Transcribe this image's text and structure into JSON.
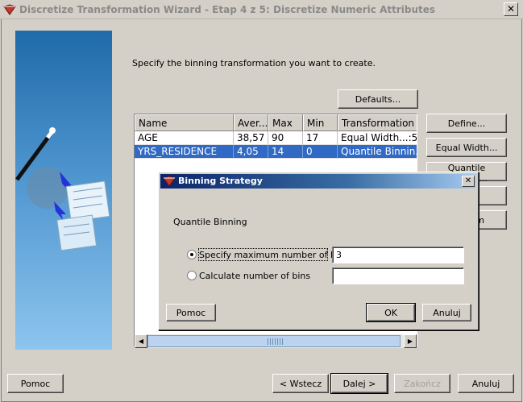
{
  "window": {
    "title": "Discretize Transformation Wizard - Etap 4 z 5: Discretize Numeric Attributes",
    "close_label": "✕"
  },
  "main": {
    "instruction": "Specify the binning transformation you want to create.",
    "defaults_label": "Defaults...",
    "side_buttons": {
      "define": "Define...",
      "equal_width": "Equal Width...",
      "quantile": "Quantile Binning...",
      "b4": "",
      "b5": "m"
    },
    "table": {
      "columns": [
        "Name",
        "Aver...",
        "Max",
        "Min",
        "Transformation"
      ],
      "rows": [
        [
          "AGE",
          "38,57",
          "90",
          "17",
          "Equal Width...:5"
        ],
        [
          "YRS_RESIDENCE",
          "4,05",
          "14",
          "0",
          "Quantile Binnin..."
        ]
      ],
      "selected_row": 1
    }
  },
  "footer": {
    "help": "Pomoc",
    "back": "< Wstecz",
    "next": "Dalej >",
    "finish": "Zakończ",
    "cancel": "Anuluj"
  },
  "dialog": {
    "title": "Binning Strategy",
    "close_label": "✕",
    "strategy_label": "Quantile Binning",
    "option_max_label": "Specify maximum number of bins",
    "option_max_value": "3",
    "option_calc_label": "Calculate number of bins",
    "option_calc_value": "",
    "help": "Pomoc",
    "ok": "OK",
    "cancel": "Anuluj"
  }
}
